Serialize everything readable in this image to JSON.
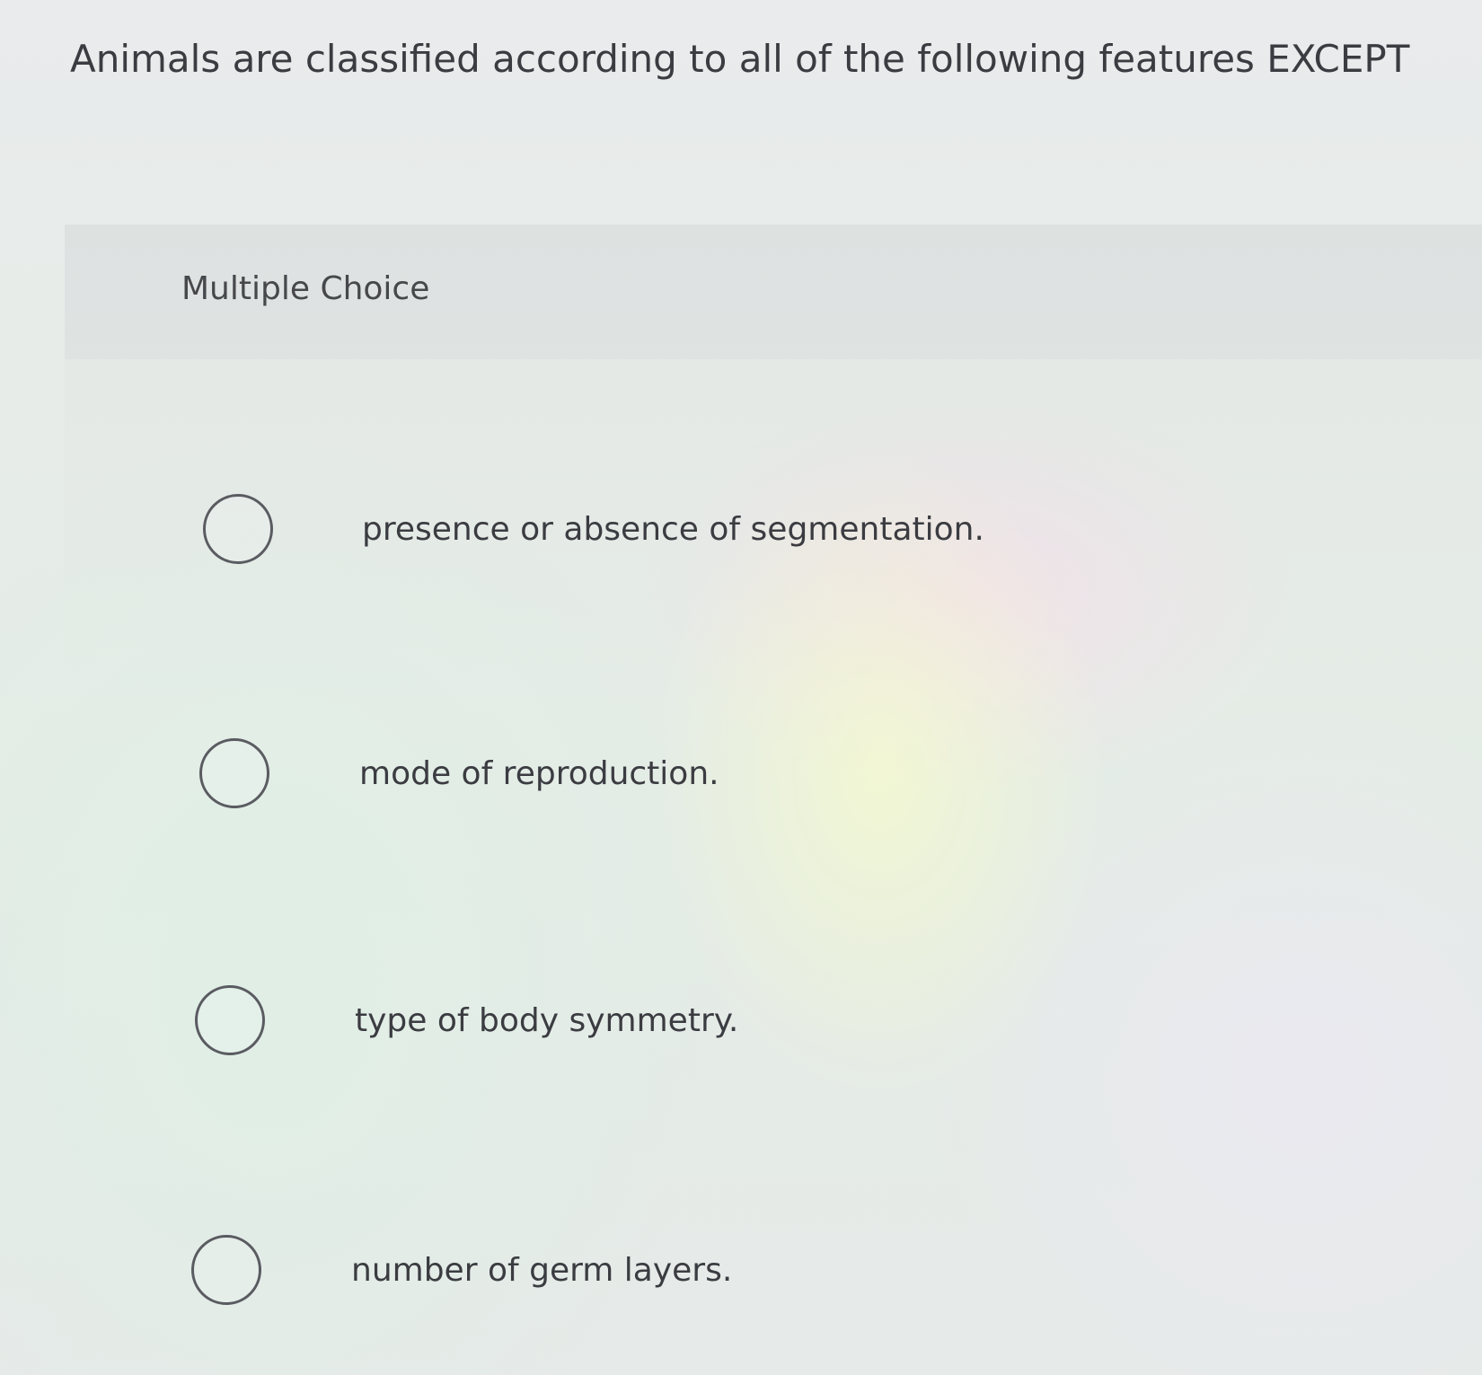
{
  "question": {
    "text": "Animals are classified according to all of the following features EXCEPT"
  },
  "question_type": "Multiple Choice",
  "options": [
    {
      "label": "presence or absence of segmentation.",
      "selected": false
    },
    {
      "label": "mode of reproduction.",
      "selected": false
    },
    {
      "label": "type of body symmetry.",
      "selected": false
    },
    {
      "label": "number of germ layers.",
      "selected": false
    }
  ]
}
